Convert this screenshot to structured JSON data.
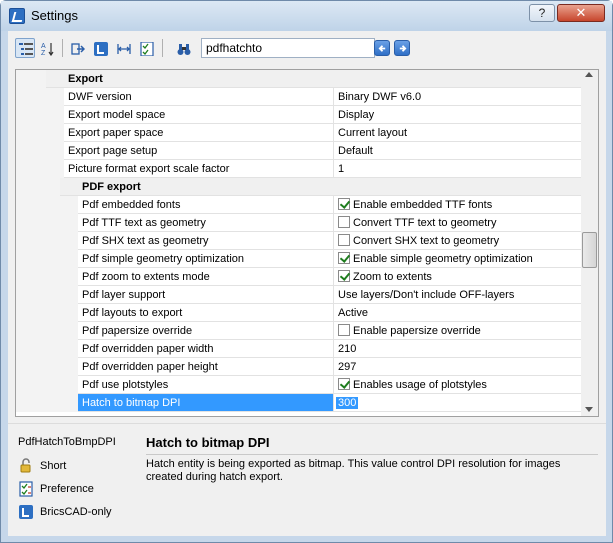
{
  "window": {
    "title": "Settings",
    "help_label": "?",
    "close_label": "✕"
  },
  "toolbar": {
    "search_value": "pdfhatchto",
    "buttons": [
      {
        "name": "categorized-view",
        "icon": "categorized-icon",
        "active": true
      },
      {
        "name": "alphabetical-view",
        "icon": "sort-az-icon",
        "active": false
      },
      {
        "name": "export-settings",
        "icon": "export-icon",
        "active": false
      },
      {
        "name": "bricscad-only",
        "icon": "bricscad-icon",
        "active": false
      },
      {
        "name": "expand-width",
        "icon": "expand-width-icon",
        "active": false
      },
      {
        "name": "preferences-filter",
        "icon": "checklist-icon",
        "active": false
      },
      {
        "name": "find",
        "icon": "binoculars-icon",
        "active": false
      }
    ]
  },
  "grid": {
    "rows": [
      {
        "type": "category",
        "level": 0,
        "label": "Export"
      },
      {
        "type": "prop",
        "level": 0,
        "label": "DWF version",
        "value": "Binary DWF v6.0"
      },
      {
        "type": "prop",
        "level": 0,
        "label": "Export model space",
        "value": "Display"
      },
      {
        "type": "prop",
        "level": 0,
        "label": "Export paper space",
        "value": "Current layout"
      },
      {
        "type": "prop",
        "level": 0,
        "label": "Export page setup",
        "value": "Default"
      },
      {
        "type": "prop",
        "level": 0,
        "label": "Picture format export scale factor",
        "value": "1"
      },
      {
        "type": "category",
        "level": 1,
        "label": "PDF export"
      },
      {
        "type": "prop",
        "level": 1,
        "label": "Pdf embedded fonts",
        "value": "Enable embedded TTF fonts",
        "checkbox": true,
        "checked": true
      },
      {
        "type": "prop",
        "level": 1,
        "label": "Pdf TTF text as geometry",
        "value": "Convert TTF text to geometry",
        "checkbox": true,
        "checked": false
      },
      {
        "type": "prop",
        "level": 1,
        "label": "Pdf SHX text as geometry",
        "value": "Convert SHX text to geometry",
        "checkbox": true,
        "checked": false
      },
      {
        "type": "prop",
        "level": 1,
        "label": "Pdf simple geometry optimization",
        "value": "Enable simple geometry optimization",
        "checkbox": true,
        "checked": true
      },
      {
        "type": "prop",
        "level": 1,
        "label": "Pdf zoom to extents mode",
        "value": "Zoom to extents",
        "checkbox": true,
        "checked": true
      },
      {
        "type": "prop",
        "level": 1,
        "label": "Pdf layer support",
        "value": "Use layers/Don't include OFF-layers"
      },
      {
        "type": "prop",
        "level": 1,
        "label": "Pdf layouts to export",
        "value": "Active"
      },
      {
        "type": "prop",
        "level": 1,
        "label": "Pdf papersize override",
        "value": "Enable papersize override",
        "checkbox": true,
        "checked": false
      },
      {
        "type": "prop",
        "level": 1,
        "label": "Pdf overridden paper width",
        "value": "210"
      },
      {
        "type": "prop",
        "level": 1,
        "label": "Pdf overridden paper height",
        "value": "297"
      },
      {
        "type": "prop",
        "level": 1,
        "label": "Pdf use plotstyles",
        "value": "Enables usage of plotstyles",
        "checkbox": true,
        "checked": true
      },
      {
        "type": "prop",
        "level": 1,
        "label": "Hatch to bitmap DPI",
        "value": "300",
        "selected": true
      }
    ]
  },
  "info": {
    "variable_name": "PdfHatchToBmpDPI",
    "items": [
      {
        "label": "Short",
        "icon": "lock-icon"
      },
      {
        "label": "Preference",
        "icon": "checklist-icon"
      },
      {
        "label": "BricsCAD-only",
        "icon": "bricscad-icon"
      }
    ],
    "title": "Hatch to bitmap DPI",
    "description": "Hatch entity is being exported as bitmap. This value control DPI resolution for images created during hatch export."
  },
  "colors": {
    "selection": "#3399ff",
    "title_gradient_top": "#dce8f4",
    "close_button": "#c7452c",
    "nav_button": "#2f6fc6",
    "bricscad_blue": "#2d6fc2"
  }
}
